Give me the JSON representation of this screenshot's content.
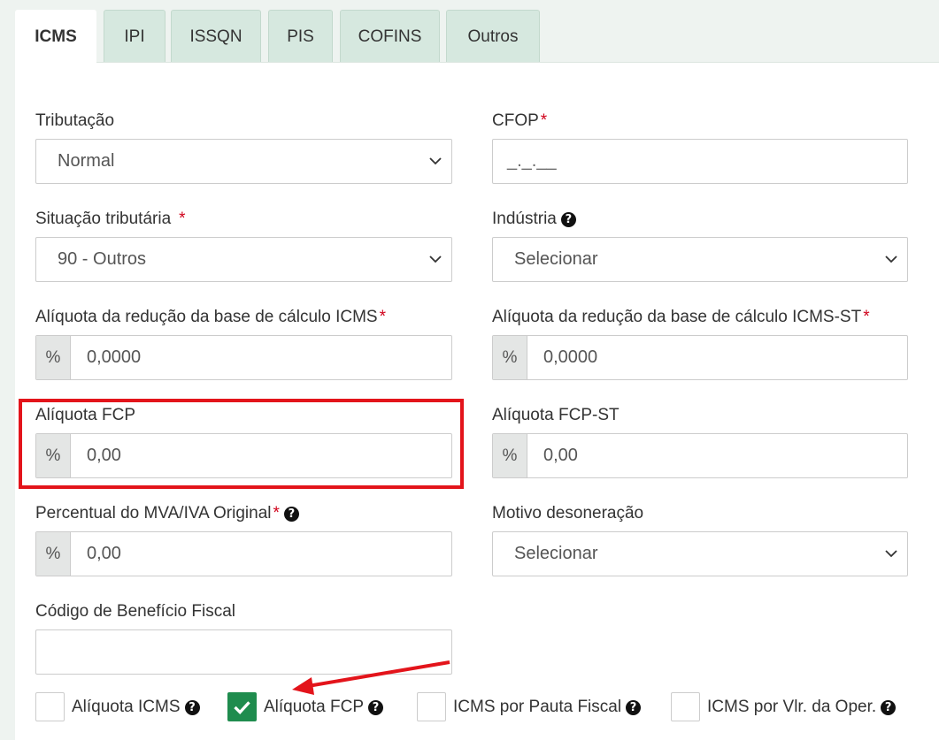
{
  "tabs": [
    {
      "label": "ICMS",
      "active": true
    },
    {
      "label": "IPI"
    },
    {
      "label": "ISSQN"
    },
    {
      "label": "PIS"
    },
    {
      "label": "COFINS"
    },
    {
      "label": "Outros"
    }
  ],
  "fields": {
    "tributacao": {
      "label": "Tributação",
      "value": "Normal"
    },
    "cfop": {
      "label": "CFOP",
      "required_mark": "*",
      "value": "_._.__"
    },
    "situacao": {
      "label": "Situação tributária",
      "required_mark": "*",
      "value": "90 - Outros"
    },
    "industria": {
      "label": "Indústria",
      "value": "Selecionar"
    },
    "aliq_red_icms": {
      "label": "Alíquota da redução da base de cálculo ICMS",
      "required_mark": "*",
      "addon": "%",
      "value": "0,0000"
    },
    "aliq_red_icms_st": {
      "label": "Alíquota da redução da base de cálculo ICMS-ST",
      "required_mark": "*",
      "addon": "%",
      "value": "0,0000"
    },
    "aliq_fcp": {
      "label": "Alíquota FCP",
      "addon": "%",
      "value": "0,00"
    },
    "aliq_fcp_st": {
      "label": "Alíquota FCP-ST",
      "addon": "%",
      "value": "0,00"
    },
    "mva": {
      "label": "Percentual do MVA/IVA Original",
      "required_mark": "*",
      "addon": "%",
      "value": "0,00"
    },
    "motivo": {
      "label": "Motivo desoneração",
      "value": "Selecionar"
    },
    "codigo_beneficio": {
      "label": "Código de Benefício Fiscal",
      "value": ""
    }
  },
  "checkboxes": [
    {
      "label": "Alíquota ICMS",
      "checked": false
    },
    {
      "label": "Alíquota FCP",
      "checked": true
    },
    {
      "label": "ICMS por Pauta Fiscal",
      "checked": false
    },
    {
      "label": "ICMS por Vlr. da Oper.",
      "checked": false
    }
  ],
  "icons": {
    "help": "question-circle-icon",
    "check": "check-icon",
    "dropdown": "chevron-down-icon"
  },
  "colors": {
    "accent": "#1f8c4e",
    "highlight": "#e3141b",
    "required": "#d0021b",
    "tab_inactive": "#d6e8df"
  }
}
